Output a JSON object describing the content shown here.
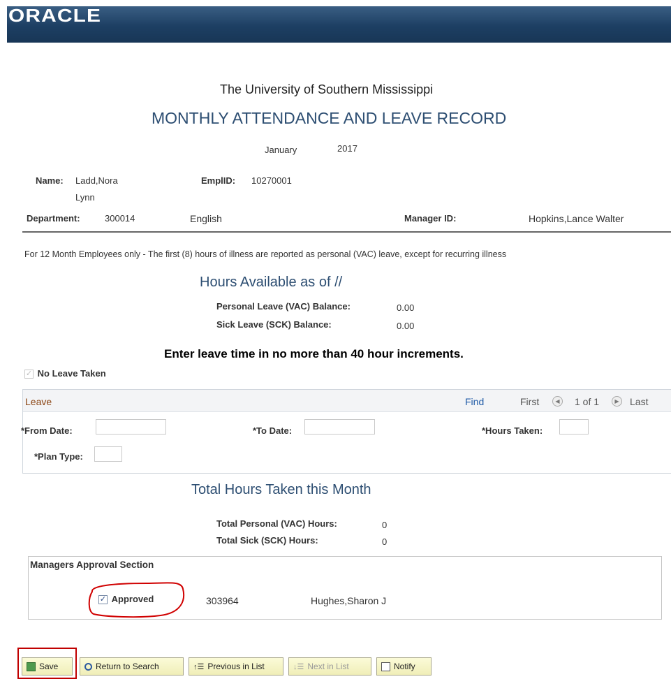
{
  "header": {
    "logo": "ORACLE"
  },
  "page": {
    "university": "The University of Southern Mississippi",
    "title": "MONTHLY ATTENDANCE AND LEAVE RECORD",
    "month": "January",
    "year": "2017"
  },
  "employee": {
    "name_label": "Name:",
    "name_line1": "Ladd,Nora",
    "name_line2": "Lynn",
    "emplid_label": "EmplID:",
    "emplid": "10270001",
    "dept_label": "Department:",
    "dept_id": "300014",
    "dept_name": "English",
    "manager_label": "Manager ID:",
    "manager_name": "Hopkins,Lance Walter"
  },
  "notice": "For 12 Month Employees only - The first (8) hours of illness are reported as personal (VAC) leave, except for recurring illness",
  "hours_available": {
    "heading": "Hours Available as of  //",
    "vac_label": "Personal Leave (VAC) Balance:",
    "vac_value": "0.00",
    "sck_label": "Sick Leave (SCK) Balance:",
    "sck_value": "0.00"
  },
  "instruction": "Enter leave time in no more than 40 hour increments.",
  "no_leave": {
    "label": "No Leave Taken",
    "checked": true
  },
  "leave_grid": {
    "title": "Leave",
    "find": "Find",
    "first": "First",
    "count": "1 of 1",
    "last": "Last",
    "from_label": "*From Date:",
    "from_value": "",
    "to_label": "*To Date:",
    "to_value": "",
    "hours_label": "*Hours Taken:",
    "hours_value": "",
    "plan_label": "*Plan Type:",
    "plan_value": ""
  },
  "totals": {
    "heading": "Total Hours Taken this Month",
    "vac_label": "Total Personal (VAC) Hours:",
    "vac_value": "0",
    "sck_label": "Total Sick (SCK) Hours:",
    "sck_value": "0"
  },
  "approval": {
    "title": "Managers Approval Section",
    "label": "Approved",
    "checked": true,
    "id": "303964",
    "name": "Hughes,Sharon J"
  },
  "toolbar": {
    "save": "Save",
    "return": "Return to Search",
    "previous": "Previous in List",
    "next": "Next in List",
    "notify": "Notify"
  },
  "colors": {
    "banner": "#1d3f63",
    "title_blue": "#2d4e72",
    "leave_label": "#8b4513",
    "annotation": "#d00000"
  }
}
